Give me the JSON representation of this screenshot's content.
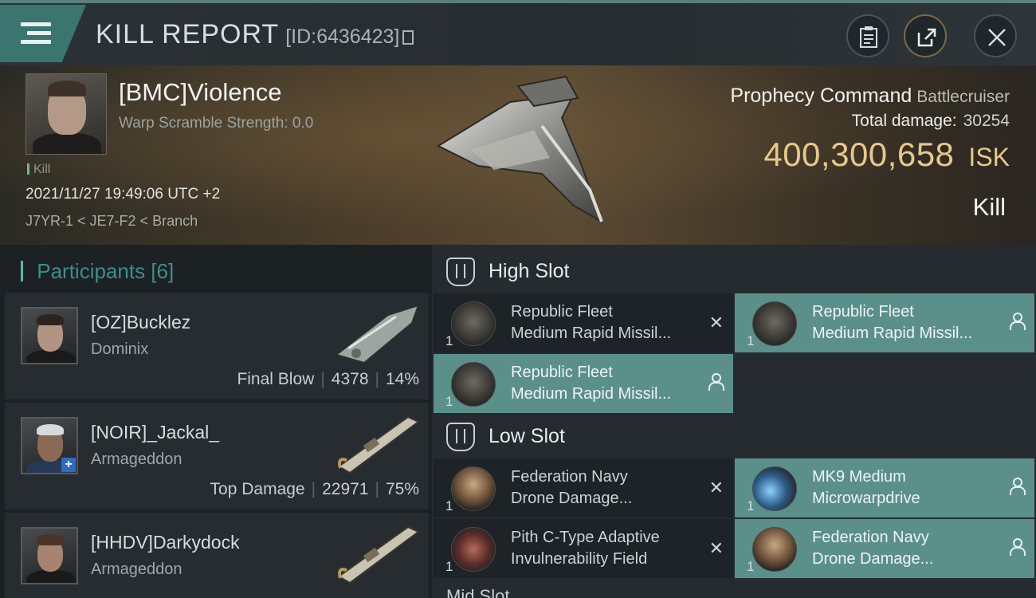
{
  "header": {
    "title": "KILL REPORT",
    "report_id": "[ID:6436423]"
  },
  "victim": {
    "name": "[BMC]Violence",
    "warp_scramble": "Warp Scramble Strength: 0.0",
    "kill_tag": "Kill",
    "datetime": "2021/11/27 19:49:06 UTC +2",
    "location": "J7YR-1 < JE7-F2 < Branch",
    "ship_name": "Prophecy Command",
    "ship_class": "Battlecruiser",
    "total_damage_label": "Total damage:",
    "total_damage": "30254",
    "isk_value": "400,300,658",
    "isk_unit": "ISK",
    "result": "Kill"
  },
  "participants": {
    "title": "Participants",
    "count": "[6]",
    "rows": [
      {
        "name": "[OZ]Bucklez",
        "ship": "Dominix",
        "role": "Final Blow",
        "damage": "4378",
        "percent": "14%"
      },
      {
        "name": "[NOIR]_Jackal_",
        "ship": "Armageddon",
        "role": "Top Damage",
        "damage": "22971",
        "percent": "75%"
      },
      {
        "name": "[HHDV]Darkydock",
        "ship": "Armageddon",
        "role": "",
        "damage": "",
        "percent": ""
      }
    ]
  },
  "fitting": {
    "high_slot_label": "High Slot",
    "low_slot_label": "Low Slot",
    "mid_slot_label": "Mid Slot",
    "high": [
      {
        "qty": "1",
        "line1": "Republic Fleet",
        "line2": "Medium Rapid Missil...",
        "state": "destroyed"
      },
      {
        "qty": "1",
        "line1": "Republic Fleet",
        "line2": "Medium Rapid Missil...",
        "state": "dropped"
      },
      {
        "qty": "1",
        "line1": "Republic Fleet",
        "line2": "Medium Rapid Missil...",
        "state": "dropped"
      }
    ],
    "low": [
      {
        "qty": "1",
        "line1": "Federation Navy",
        "line2": "Drone Damage...",
        "state": "destroyed"
      },
      {
        "qty": "1",
        "line1": "MK9 Medium",
        "line2": "Microwarpdrive",
        "state": "dropped"
      },
      {
        "qty": "1",
        "line1": "Pith C-Type Adaptive",
        "line2": "Invulnerability Field",
        "state": "destroyed"
      },
      {
        "qty": "1",
        "line1": "Federation Navy",
        "line2": "Drone Damage...",
        "state": "dropped"
      }
    ]
  },
  "colors": {
    "accent_teal": "#5b8f8a",
    "isk_gold": "#e7c88c"
  },
  "icons": {
    "menu": "hamburger-icon",
    "clipboard": "clipboard-icon",
    "share": "share-icon",
    "close": "close-icon",
    "destroyed": "x-icon",
    "dropped": "person-icon"
  }
}
